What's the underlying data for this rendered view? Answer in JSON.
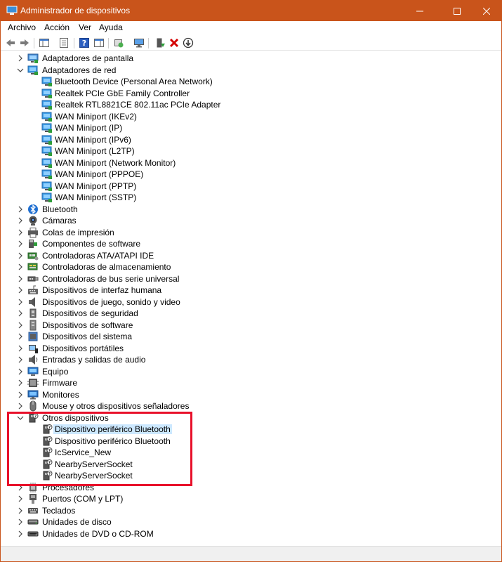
{
  "window": {
    "title": "Administrador de dispositivos",
    "accent_color": "#c9541b",
    "highlight_color": "#e8102a",
    "selection_color": "#cce8ff"
  },
  "menu": [
    "Archivo",
    "Acción",
    "Ver",
    "Ayuda"
  ],
  "toolbar_icons": [
    "back-icon",
    "forward-icon",
    "show-hide-console-tree-icon",
    "properties-icon",
    "help-icon",
    "action-pane-icon",
    "update-driver-icon",
    "scan-hardware-icon",
    "enable-device-icon",
    "uninstall-device-icon",
    "disable-device-icon"
  ],
  "tree": [
    {
      "label": "Adaptadores de pantalla",
      "level": 0,
      "state": "collapsed",
      "icon": "display-adapter-icon"
    },
    {
      "label": "Adaptadores de red",
      "level": 0,
      "state": "expanded",
      "icon": "network-adapter-icon"
    },
    {
      "label": "Bluetooth Device (Personal Area Network)",
      "level": 1,
      "icon": "network-adapter-icon"
    },
    {
      "label": "Realtek PCIe GbE Family Controller",
      "level": 1,
      "icon": "network-adapter-icon"
    },
    {
      "label": "Realtek RTL8821CE 802.11ac PCIe Adapter",
      "level": 1,
      "icon": "network-adapter-icon"
    },
    {
      "label": "WAN Miniport (IKEv2)",
      "level": 1,
      "icon": "network-adapter-icon"
    },
    {
      "label": "WAN Miniport (IP)",
      "level": 1,
      "icon": "network-adapter-icon"
    },
    {
      "label": "WAN Miniport (IPv6)",
      "level": 1,
      "icon": "network-adapter-icon"
    },
    {
      "label": "WAN Miniport (L2TP)",
      "level": 1,
      "icon": "network-adapter-icon"
    },
    {
      "label": "WAN Miniport (Network Monitor)",
      "level": 1,
      "icon": "network-adapter-icon"
    },
    {
      "label": "WAN Miniport (PPPOE)",
      "level": 1,
      "icon": "network-adapter-icon"
    },
    {
      "label": "WAN Miniport (PPTP)",
      "level": 1,
      "icon": "network-adapter-icon"
    },
    {
      "label": "WAN Miniport (SSTP)",
      "level": 1,
      "icon": "network-adapter-icon"
    },
    {
      "label": "Bluetooth",
      "level": 0,
      "state": "collapsed",
      "icon": "bluetooth-icon"
    },
    {
      "label": "Cámaras",
      "level": 0,
      "state": "collapsed",
      "icon": "camera-icon"
    },
    {
      "label": "Colas de impresión",
      "level": 0,
      "state": "collapsed",
      "icon": "printer-icon"
    },
    {
      "label": "Componentes de software",
      "level": 0,
      "state": "collapsed",
      "icon": "software-component-icon"
    },
    {
      "label": "Controladoras ATA/ATAPI IDE",
      "level": 0,
      "state": "collapsed",
      "icon": "ide-controller-icon"
    },
    {
      "label": "Controladoras de almacenamiento",
      "level": 0,
      "state": "collapsed",
      "icon": "storage-controller-icon"
    },
    {
      "label": "Controladoras de bus serie universal",
      "level": 0,
      "state": "collapsed",
      "icon": "usb-icon"
    },
    {
      "label": "Dispositivos de interfaz humana",
      "level": 0,
      "state": "collapsed",
      "icon": "hid-icon"
    },
    {
      "label": "Dispositivos de juego, sonido y video",
      "level": 0,
      "state": "collapsed",
      "icon": "speaker-icon"
    },
    {
      "label": "Dispositivos de seguridad",
      "level": 0,
      "state": "collapsed",
      "icon": "security-device-icon"
    },
    {
      "label": "Dispositivos de software",
      "level": 0,
      "state": "collapsed",
      "icon": "software-device-icon"
    },
    {
      "label": "Dispositivos del sistema",
      "level": 0,
      "state": "collapsed",
      "icon": "system-device-icon"
    },
    {
      "label": "Dispositivos portátiles",
      "level": 0,
      "state": "collapsed",
      "icon": "portable-device-icon"
    },
    {
      "label": "Entradas y salidas de audio",
      "level": 0,
      "state": "collapsed",
      "icon": "audio-io-icon"
    },
    {
      "label": "Equipo",
      "level": 0,
      "state": "collapsed",
      "icon": "computer-icon"
    },
    {
      "label": "Firmware",
      "level": 0,
      "state": "collapsed",
      "icon": "firmware-icon"
    },
    {
      "label": "Monitores",
      "level": 0,
      "state": "collapsed",
      "icon": "monitor-icon"
    },
    {
      "label": "Mouse y otros dispositivos señaladores",
      "level": 0,
      "state": "collapsed",
      "icon": "mouse-icon"
    },
    {
      "label": "Otros dispositivos",
      "level": 0,
      "state": "expanded",
      "icon": "unknown-device-icon"
    },
    {
      "label": "Dispositivo periférico Bluetooth",
      "level": 1,
      "icon": "unknown-device-icon",
      "selected": true
    },
    {
      "label": "Dispositivo periférico Bluetooth",
      "level": 1,
      "icon": "unknown-device-icon"
    },
    {
      "label": "IcService_New",
      "level": 1,
      "icon": "unknown-device-icon"
    },
    {
      "label": "NearbyServerSocket",
      "level": 1,
      "icon": "unknown-device-icon"
    },
    {
      "label": "NearbyServerSocket",
      "level": 1,
      "icon": "unknown-device-icon"
    },
    {
      "label": "Procesadores",
      "level": 0,
      "state": "collapsed",
      "icon": "processor-icon"
    },
    {
      "label": "Puertos (COM y LPT)",
      "level": 0,
      "state": "collapsed",
      "icon": "port-icon"
    },
    {
      "label": "Teclados",
      "level": 0,
      "state": "collapsed",
      "icon": "keyboard-icon"
    },
    {
      "label": "Unidades de disco",
      "level": 0,
      "state": "collapsed",
      "icon": "disk-drive-icon"
    },
    {
      "label": "Unidades de DVD o CD-ROM",
      "level": 0,
      "state": "collapsed",
      "icon": "dvd-drive-icon"
    }
  ]
}
